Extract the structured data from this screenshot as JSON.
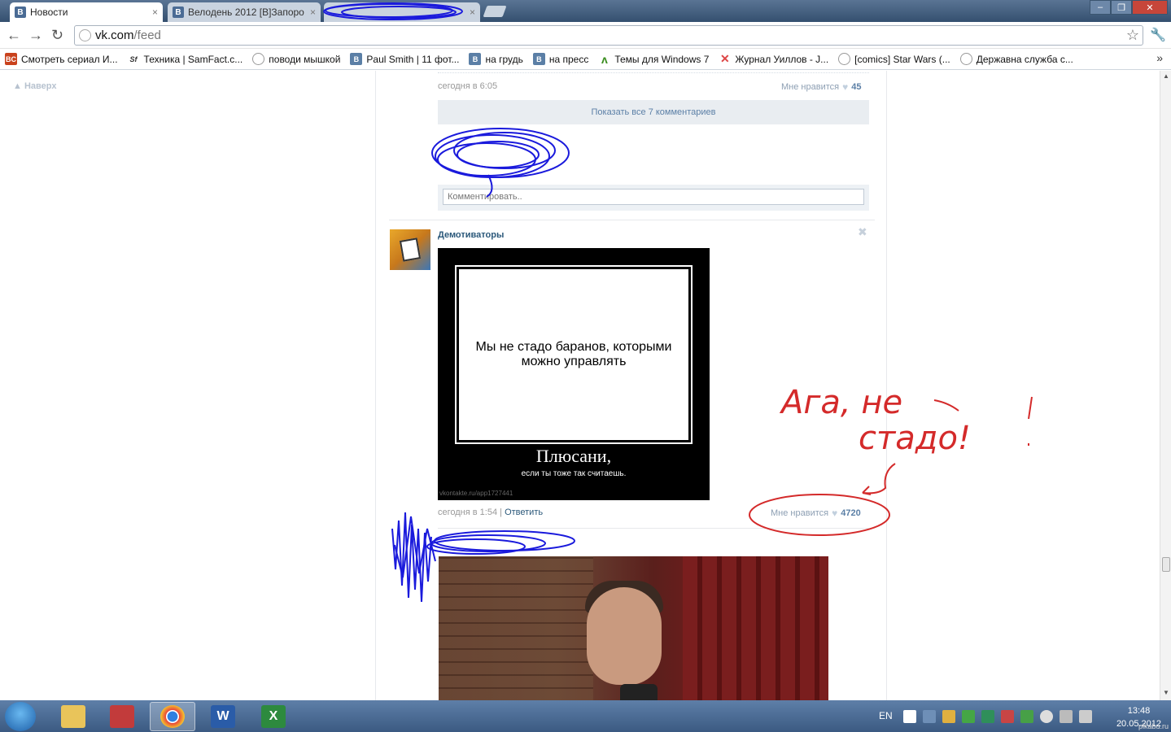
{
  "browser": {
    "tabs": [
      {
        "label": "Новости",
        "icon": "B",
        "active": true
      },
      {
        "label": "Велодень 2012 [В]Запоро",
        "icon": "B",
        "active": false
      },
      {
        "label": "",
        "icon": "",
        "active": false
      }
    ],
    "url_host": "vk.com",
    "url_path": "/feed",
    "bookmarks": [
      {
        "label": "Смотреть сериал И...",
        "icon": "BC"
      },
      {
        "label": "Техника | SamFact.c...",
        "icon": "Sf"
      },
      {
        "label": "поводи мышкой",
        "icon": "globe"
      },
      {
        "label": "Paul Smith | 11 фот...",
        "icon": "B"
      },
      {
        "label": "на грудь",
        "icon": "B"
      },
      {
        "label": "на пресс",
        "icon": "B"
      },
      {
        "label": "Темы для Windows 7",
        "icon": "leaf"
      },
      {
        "label": "Журнал Уиллов - J...",
        "icon": "x"
      },
      {
        "label": "[comics] Star Wars (...",
        "icon": "globe"
      },
      {
        "label": "Державна служба с...",
        "icon": "globe"
      }
    ],
    "more": "»"
  },
  "page": {
    "up_label": "Наверх",
    "post1": {
      "time": "сегодня в 6:05",
      "likes_label": "Мне нравится",
      "likes_count": "45",
      "show_all": "Показать все 7 комментариев",
      "comment_placeholder": "Комментировать.."
    },
    "post2": {
      "author": "Демотиваторы",
      "demot_text": "Мы не стадо баранов, которыми можно управлять",
      "demot_title": "Плюсани,",
      "demot_sub": "если ты тоже так считаешь.",
      "demot_watermark": "vkontakte.ru/app1727441",
      "time": "сегодня в 1:54",
      "separator": "|",
      "reply": "Ответить",
      "likes_label": "Мне нравится",
      "likes_count": "4720"
    }
  },
  "annotation": {
    "handwriting_line1": "Ага, не",
    "handwriting_line2": "стадо!",
    "color": "#d42a2a",
    "scribble_color": "#1a1adc"
  },
  "taskbar": {
    "apps": [
      "explorer",
      "save",
      "chrome",
      "word",
      "excel"
    ],
    "lang": "EN",
    "time": "13:48",
    "date": "20.05.2012",
    "watermark": "pikabu.ru"
  }
}
